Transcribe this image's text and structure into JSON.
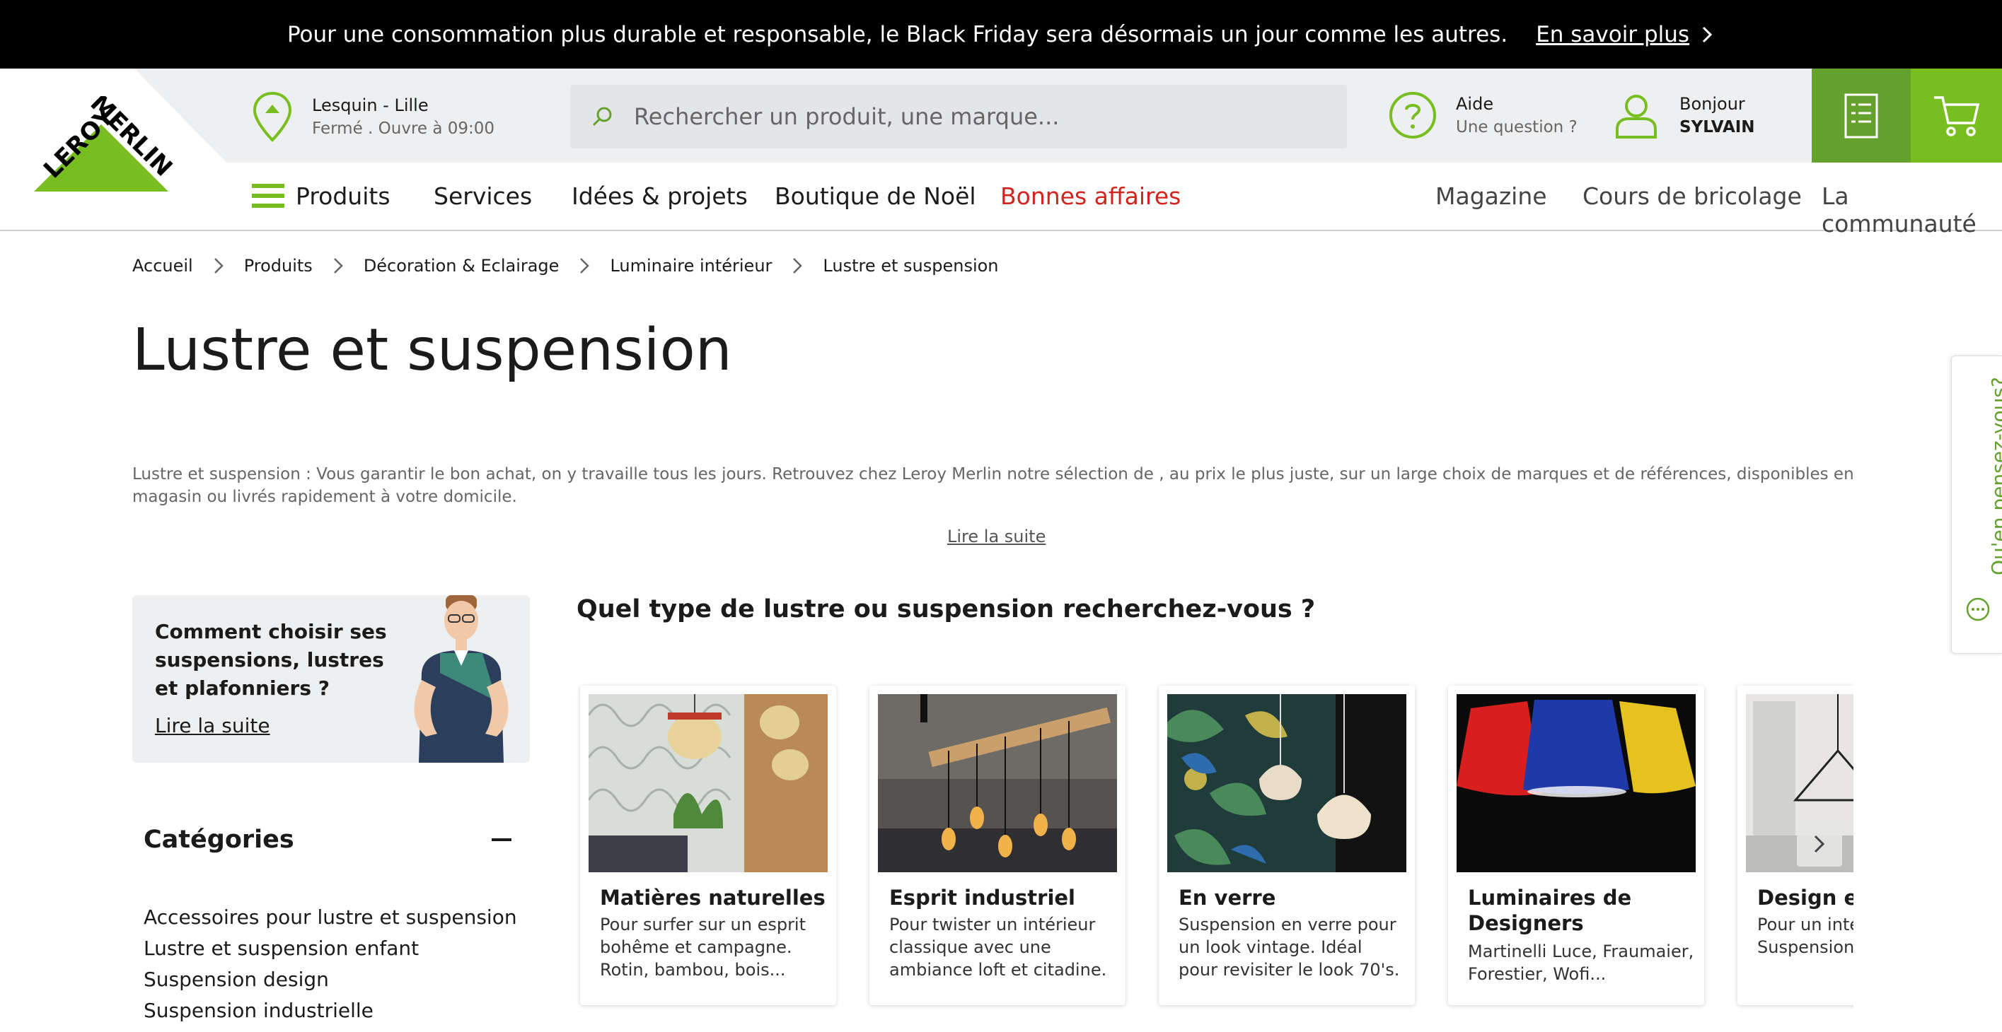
{
  "banner": {
    "text": "Pour une consommation plus durable et responsable, le Black Friday sera désormais un jour comme les autres.",
    "link": "En savoir plus"
  },
  "header": {
    "logo_icon": "leroy-merlin-logo",
    "store": {
      "name": "Lesquin - Lille",
      "status": "Fermé . Ouvre à 09:00"
    },
    "search": {
      "placeholder": "Rechercher un produit, une marque..."
    },
    "help": {
      "title": "Aide",
      "subtitle": "Une question ?"
    },
    "account": {
      "greeting": "Bonjour",
      "name": "SYLVAIN"
    }
  },
  "nav": {
    "main": [
      "Produits",
      "Services",
      "Idées & projets",
      "Boutique de Noël",
      "Bonnes affaires"
    ],
    "secondary": [
      "Magazine",
      "Cours de bricolage",
      "La communauté"
    ]
  },
  "breadcrumb": [
    "Accueil",
    "Produits",
    "Décoration & Eclairage",
    "Luminaire intérieur",
    "Lustre et suspension"
  ],
  "page": {
    "title": "Lustre et suspension",
    "intro": "Lustre et suspension : Vous garantir le bon achat, on y travaille tous les jours. Retrouvez chez Leroy Merlin notre sélection de , au prix le plus juste, sur un large choix de marques et de références, disponibles en magasin ou livrés rapidement à votre domicile.",
    "read_more": "Lire la suite"
  },
  "guide": {
    "title": "Comment choisir ses suspensions, lustres et plafonniers ?",
    "link": "Lire la suite"
  },
  "categories": {
    "title": "Catégories",
    "items": [
      "Accessoires pour lustre et suspension",
      "Lustre et suspension enfant",
      "Suspension design",
      "Suspension industrielle"
    ]
  },
  "types": {
    "title": "Quel type de lustre ou suspension recherchez-vous ?",
    "cards": [
      {
        "title": "Matières naturelles",
        "desc": "Pour surfer sur un esprit bohême et campagne. Rotin, bambou, bois..."
      },
      {
        "title": "Esprit industriel",
        "desc": "Pour twister un intérieur classique avec une ambiance loft et citadine."
      },
      {
        "title": "En verre",
        "desc": "Suspension en verre pour un look vintage. Idéal pour revisiter le look 70's."
      },
      {
        "title": "Luminaires de Designers",
        "desc": "Martinelli Luce, Fraumaier, Forestier, Wofi..."
      },
      {
        "title": "Design et f",
        "desc": "Pour un intér moderne voi Suspension f"
      }
    ]
  },
  "feedback": {
    "label": "Qu'en pensez-vous?"
  },
  "colors": {
    "brand_green": "#78be20",
    "dark_green": "#65a12d",
    "promo_red": "#d0241d"
  }
}
